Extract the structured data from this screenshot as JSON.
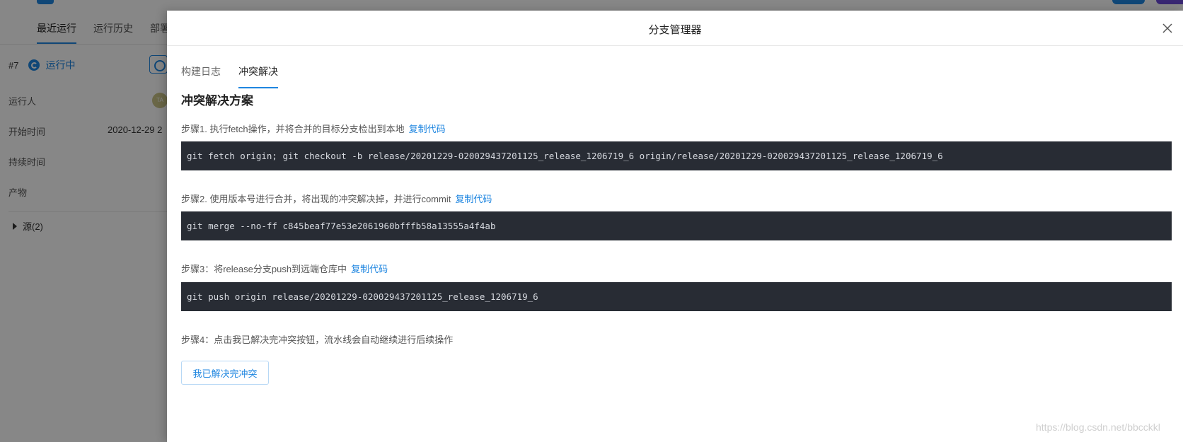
{
  "background": {
    "tabs": [
      "最近运行",
      "运行历史",
      "部署"
    ],
    "run": {
      "number": "#7",
      "status": "运行中",
      "status_icon": "running-icon",
      "stop_icon": "stop-icon"
    },
    "fields": [
      {
        "label": "运行人",
        "value": ""
      },
      {
        "label": "开始时间",
        "value": "2020-12-29 2"
      },
      {
        "label": "持续时间",
        "value": ""
      },
      {
        "label": "产物",
        "value": ""
      }
    ],
    "avatar_text": "TA",
    "source_label": "源(2)"
  },
  "drawer": {
    "title": "分支管理器",
    "tabs": [
      "构建日志",
      "冲突解决"
    ],
    "active_tab": "冲突解决",
    "section_title": "冲突解决方案",
    "copy_label": "复制代码",
    "steps": [
      {
        "label": "步骤1. 执行fetch操作，并将合并的目标分支检出到本地",
        "code": "git fetch origin; git checkout -b release/20201229-020029437201125_release_1206719_6 origin/release/20201229-020029437201125_release_1206719_6"
      },
      {
        "label": "步骤2. 使用版本号进行合并，将出现的冲突解决掉，并进行commit",
        "code": "git merge --no-ff c845beaf77e53e2061960bfffb58a13555a4f4ab"
      },
      {
        "label": "步骤3：将release分支push到远端仓库中",
        "code": "git push origin release/20201229-020029437201125_release_1206719_6"
      },
      {
        "label": "步骤4：点击我已解决完冲突按钮，流水线会自动继续进行后续操作"
      }
    ],
    "resolve_button": "我已解决完冲突"
  },
  "watermark": "https://blog.csdn.net/bbcckkl",
  "colors": {
    "accent": "#1f86e0",
    "code_bg": "#282c34",
    "code_text": "#d7dae0",
    "mask": "rgba(0,0,0,0.47)"
  }
}
